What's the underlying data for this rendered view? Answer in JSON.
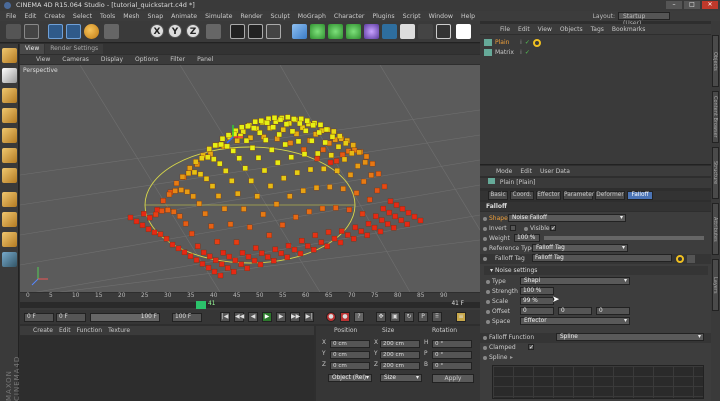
{
  "title": "CINEMA 4D R15.064 Studio - [tutorial_quickstart.c4d *]",
  "menu": [
    "File",
    "Edit",
    "Create",
    "Select",
    "Tools",
    "Mesh",
    "Snap",
    "Animate",
    "Simulate",
    "Render",
    "Sculpt",
    "MoGraph",
    "Character",
    "Plugins",
    "Script",
    "Window",
    "Help"
  ],
  "layout": {
    "label": "Layout:",
    "value": "Startup (User)"
  },
  "toolbar": {
    "x": "X",
    "y": "Y",
    "z": "Z"
  },
  "viewport": {
    "tabs": [
      "View",
      "Render Settings"
    ],
    "menu": [
      "View",
      "Cameras",
      "Display",
      "Options",
      "Filter",
      "Panel"
    ],
    "label": "Perspective"
  },
  "timeline": {
    "ticks": [
      "0",
      "5",
      "10",
      "15",
      "20",
      "25",
      "30",
      "35",
      "40",
      "45",
      "50",
      "55",
      "60",
      "65",
      "70",
      "75",
      "80",
      "85",
      "90"
    ],
    "current_frame_badge": "41",
    "end_label": "41 F",
    "start_field": "0 F",
    "min_field": "0 F",
    "max_field": "100 F",
    "end_field": "100 F"
  },
  "material": {
    "menu": [
      "Create",
      "Edit",
      "Function",
      "Texture"
    ]
  },
  "maxon": "MAXON CINEMA4D",
  "coords": {
    "headers": [
      "Position",
      "Size",
      "Rotation"
    ],
    "rows": [
      {
        "axis": "X",
        "pos": "0 cm",
        "size": "200 cm",
        "rlabel": "H",
        "rot": "0 °"
      },
      {
        "axis": "Y",
        "pos": "0 cm",
        "size": "200 cm",
        "rlabel": "P",
        "rot": "0 °"
      },
      {
        "axis": "Z",
        "pos": "0 cm",
        "size": "200 cm",
        "rlabel": "B",
        "rot": "0 °"
      }
    ],
    "mode": "Object (Rel)",
    "size_mode": "Size",
    "apply": "Apply"
  },
  "objects": {
    "menu": [
      "File",
      "Edit",
      "View",
      "Objects",
      "Tags",
      "Bookmarks"
    ],
    "items": [
      "Plain",
      "Matrix"
    ]
  },
  "attributes": {
    "menu": [
      "Mode",
      "Edit",
      "User Data"
    ],
    "title": "Plain [Plain]",
    "tabs": [
      "Basic",
      "Coord.",
      "Effector",
      "Parameter",
      "Deformer",
      "Falloff"
    ],
    "section": "Falloff",
    "shape_label": "Shape",
    "shape": "Noise Falloff",
    "invert_label": "Invert",
    "visible_label": "Visible",
    "weight_label": "Weight",
    "weight": "100 %",
    "reftype_label": "Reference Type",
    "reftype": "Falloff Tag",
    "ftag_label": "Falloff Tag",
    "ftag": "Falloff Tag",
    "noise_section": "Noise settings",
    "type_label": "Type",
    "type": "Shapi",
    "strength_label": "Strength",
    "strength": "100 %",
    "scale_label": "Scale",
    "scale": "99 %",
    "offset_label": "Offset",
    "offset": [
      "0",
      "0",
      "0"
    ],
    "space_label": "Space",
    "space": "Effector",
    "ff_label": "Falloff Function",
    "ff": "Spline",
    "clamped_label": "Clamped",
    "spline_label": "Spline"
  },
  "side_tabs": [
    "Objects",
    "Content Browser",
    "Structure",
    "Attributes",
    "Layers"
  ],
  "colors": {
    "accent": "#4b74b5",
    "orange": "#f0a03a"
  }
}
